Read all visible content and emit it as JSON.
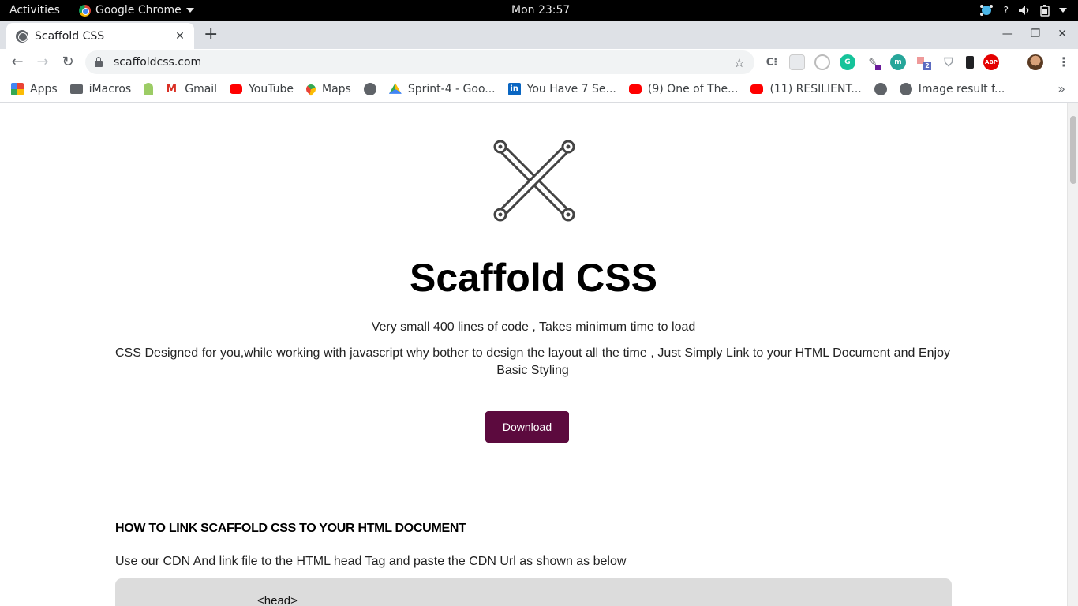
{
  "system_bar": {
    "activities": "Activities",
    "app_name": "Google Chrome",
    "clock": "Mon 23:57"
  },
  "tab": {
    "title": "Scaffold CSS",
    "close": "✕"
  },
  "window_controls": {
    "minimize": "—",
    "maximize": "❐",
    "close": "✕"
  },
  "toolbar": {
    "url": "scaffoldcss.com",
    "extension_icons": [
      "c-icon",
      "blank-ext-icon",
      "clock-ext-icon",
      "grammarly-icon",
      "pen-ext-icon",
      "m-ext-icon",
      "tab-counter-icon",
      "shield-ext-icon",
      "phone-ext-icon",
      "abp-icon"
    ],
    "tab_counter_badge": "2",
    "abp_label": "ABP"
  },
  "bookmarks": [
    {
      "label": "Apps",
      "icon": "apps-grid-icon"
    },
    {
      "label": "iMacros",
      "icon": "folder-icon"
    },
    {
      "label": "",
      "icon": "android-icon"
    },
    {
      "label": "Gmail",
      "icon": "gmail-icon"
    },
    {
      "label": "YouTube",
      "icon": "youtube-icon"
    },
    {
      "label": "Maps",
      "icon": "maps-icon"
    },
    {
      "label": "",
      "icon": "globe-icon"
    },
    {
      "label": "Sprint-4 - Goo...",
      "icon": "drive-icon"
    },
    {
      "label": "You Have 7 Se...",
      "icon": "linkedin-icon"
    },
    {
      "label": "(9) One of The...",
      "icon": "youtube-icon"
    },
    {
      "label": "(11) RESILIENT...",
      "icon": "youtube-icon"
    },
    {
      "label": "",
      "icon": "globe-icon"
    },
    {
      "label": "Image result f...",
      "icon": "globe-icon"
    }
  ],
  "page": {
    "title": "Scaffold CSS",
    "tagline": "Very small 400 lines of code , Takes minimum time to load",
    "description": "CSS Designed for you,while working with javascript why bother to design the layout all the time , Just Simply Link to your HTML Document and Enjoy Basic Styling",
    "download_label": "Download",
    "section_heading": "HOW TO LINK SCAFFOLD CSS TO YOUR HTML DOCUMENT",
    "section_text": "Use our CDN And link file to the HTML head Tag and paste the CDN Url as shown as below",
    "code_line": "<head>"
  },
  "colors": {
    "download_button": "#5c0a3e",
    "code_background": "#dcdcdc"
  }
}
